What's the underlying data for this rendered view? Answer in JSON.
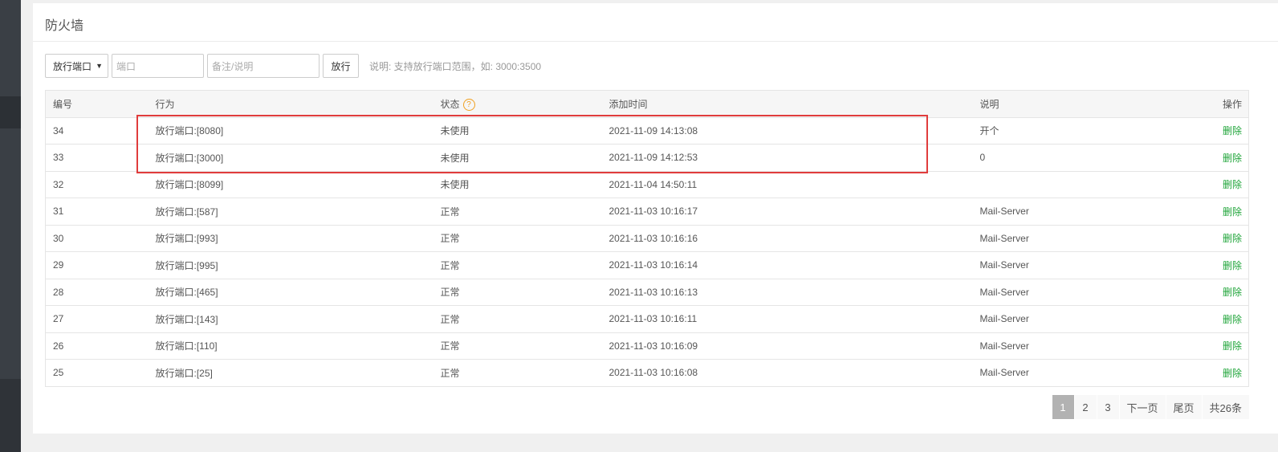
{
  "panel": {
    "title": "防火墙"
  },
  "toolbar": {
    "select_value": "放行端口",
    "port_placeholder": "端口",
    "note_placeholder": "备注/说明",
    "submit_label": "放行",
    "hint": "说明: 支持放行端口范围，如: 3000:3500"
  },
  "table": {
    "headers": {
      "id": "编号",
      "action": "行为",
      "status": "状态",
      "time": "添加时间",
      "note": "说明",
      "op": "操作"
    },
    "rows": [
      {
        "id": "34",
        "action": "放行端口:[8080]",
        "status": "未使用",
        "time": "2021-11-09 14:13:08",
        "note": "开个",
        "op": "删除"
      },
      {
        "id": "33",
        "action": "放行端口:[3000]",
        "status": "未使用",
        "time": "2021-11-09 14:12:53",
        "note": "0",
        "op": "删除"
      },
      {
        "id": "32",
        "action": "放行端口:[8099]",
        "status": "未使用",
        "time": "2021-11-04 14:50:11",
        "note": "",
        "op": "删除"
      },
      {
        "id": "31",
        "action": "放行端口:[587]",
        "status": "正常",
        "time": "2021-11-03 10:16:17",
        "note": "Mail-Server",
        "op": "删除"
      },
      {
        "id": "30",
        "action": "放行端口:[993]",
        "status": "正常",
        "time": "2021-11-03 10:16:16",
        "note": "Mail-Server",
        "op": "删除"
      },
      {
        "id": "29",
        "action": "放行端口:[995]",
        "status": "正常",
        "time": "2021-11-03 10:16:14",
        "note": "Mail-Server",
        "op": "删除"
      },
      {
        "id": "28",
        "action": "放行端口:[465]",
        "status": "正常",
        "time": "2021-11-03 10:16:13",
        "note": "Mail-Server",
        "op": "删除"
      },
      {
        "id": "27",
        "action": "放行端口:[143]",
        "status": "正常",
        "time": "2021-11-03 10:16:11",
        "note": "Mail-Server",
        "op": "删除"
      },
      {
        "id": "26",
        "action": "放行端口:[110]",
        "status": "正常",
        "time": "2021-11-03 10:16:09",
        "note": "Mail-Server",
        "op": "删除"
      },
      {
        "id": "25",
        "action": "放行端口:[25]",
        "status": "正常",
        "time": "2021-11-03 10:16:08",
        "note": "Mail-Server",
        "op": "删除"
      }
    ]
  },
  "pager": {
    "p1": "1",
    "p2": "2",
    "p3": "3",
    "next": "下一页",
    "last": "尾页",
    "total": "共26条"
  },
  "colors": {
    "accent_green": "#20a53a",
    "highlight_red": "#e03c3c",
    "help_orange": "#f0a020"
  },
  "icons": {
    "help": "question-circle-icon",
    "select": "chevron-down-icon"
  }
}
